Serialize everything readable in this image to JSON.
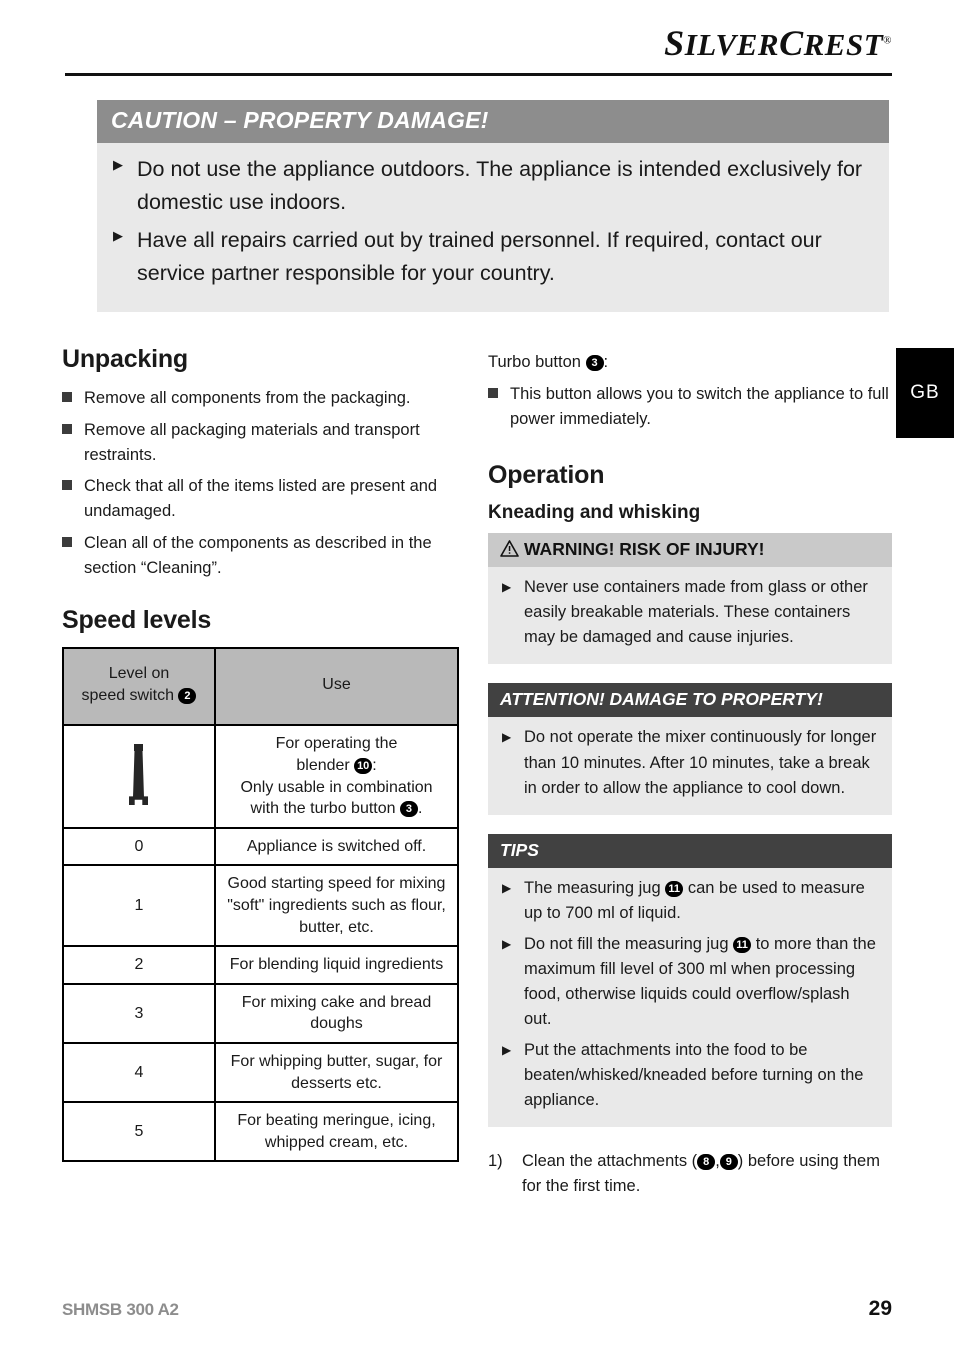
{
  "brand": {
    "part1": "S",
    "part2": "ILVER",
    "part3": "C",
    "part4": "REST",
    "registered": "®"
  },
  "language_tab": "GB",
  "caution_box": {
    "title": "CAUTION – PROPERTY DAMAGE!",
    "items": [
      "Do not use the appliance outdoors. The appliance is intended exclusively for domestic use indoors.",
      "Have all repairs carried out by trained personnel. If required, contact our service partner responsible for your country."
    ]
  },
  "left_column": {
    "unpacking": {
      "heading": "Unpacking",
      "items": [
        "Remove all components from the packaging.",
        "Remove all packaging materials and transport restraints.",
        "Check that all of the items listed are present and undamaged.",
        "Clean all of the components as described in the section “Cleaning”."
      ]
    },
    "speed_levels": {
      "heading": "Speed levels",
      "columns": [
        "Level on speed switch",
        "Use"
      ],
      "column1_header_line1": "Level on",
      "column1_header_line2": "speed switch",
      "column1_header_badge": "2",
      "column2_header": "Use",
      "rows": [
        {
          "level": "blender-icon",
          "level_is_icon": true,
          "use_line1": "For operating the",
          "use_line2_pre": "blender ",
          "use_line2_badge": "10",
          "use_line2_post": ":",
          "use_line3": "Only usable in combination",
          "use_line4_pre": "with the turbo button ",
          "use_line4_badge": "3",
          "use_line4_post": "."
        },
        {
          "level": "0",
          "use": "Appliance is switched off."
        },
        {
          "level": "1",
          "use": "Good starting speed for mixing \"soft\" ingredients such as flour, butter, etc."
        },
        {
          "level": "2",
          "use": "For blending liquid ingredients"
        },
        {
          "level": "3",
          "use": "For mixing cake and bread doughs"
        },
        {
          "level": "4",
          "use": "For whipping butter, sugar, for desserts etc."
        },
        {
          "level": "5",
          "use": "For beating meringue, icing, whipped cream, etc."
        }
      ]
    }
  },
  "right_column": {
    "turbo": {
      "label_pre": "Turbo button ",
      "label_badge": "3",
      "label_post": ":",
      "items": [
        "This button allows you to switch the appliance to full power immediately."
      ]
    },
    "operation_heading": "Operation",
    "kneading_heading": "Kneading and whisking",
    "warning_box": {
      "title": "WARNING! RISK OF INJURY!",
      "items": [
        "Never use containers made from glass or other easily breakable materials. These containers may be damaged and cause injuries."
      ]
    },
    "attention_box": {
      "title": "ATTENTION! DAMAGE TO PROPERTY!",
      "items": [
        "Do not operate the mixer continuously for longer than 10 minutes. After 10 minutes, take a break in order to allow the appliance to cool down."
      ]
    },
    "tips_box": {
      "title": "TIPS",
      "items": [
        {
          "pre": "The measuring jug ",
          "badge": "11",
          "post": " can be used to measure up to 700 ml of liquid."
        },
        {
          "pre": "Do not fill the measuring jug ",
          "badge": "11",
          "post": " to more than the maximum fill level of 300 ml when processing food, otherwise liquids could overflow/splash out."
        },
        {
          "pre": "Put the attachments into the food to be beaten/whisked/kneaded before turning on the appliance.",
          "badge": "",
          "post": ""
        }
      ]
    },
    "steps": [
      {
        "num": "1)",
        "pre": "Clean the attachments (",
        "badge1": "8",
        "mid": ",",
        "badge2": "9",
        "post": ") before using them for the first time."
      }
    ]
  },
  "footer": {
    "model": "SHMSB 300 A2",
    "page": "29"
  },
  "colors": {
    "caution_header": "#8d8d8d",
    "notice_body": "#e9e9e9",
    "dark_header": "#414141",
    "light_header": "#c9c9c9",
    "table_header": "#b9b9b9",
    "footer_model": "#8d8d8d"
  }
}
